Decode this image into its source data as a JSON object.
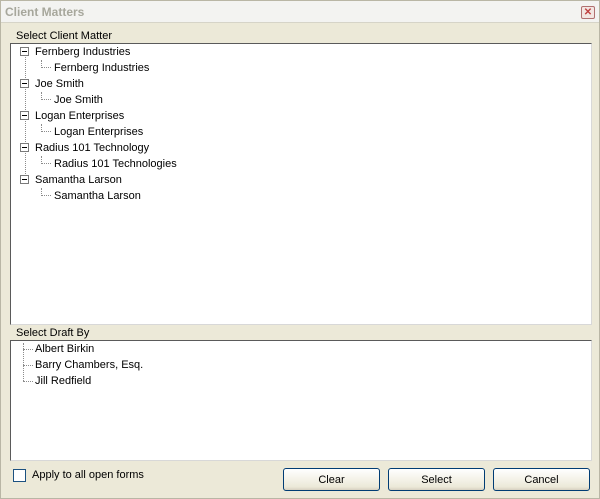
{
  "window": {
    "title": "Client Matters"
  },
  "client_matter": {
    "label": "Select Client Matter",
    "nodes": [
      {
        "label": "Fernberg Industries",
        "child": "Fernberg Industries"
      },
      {
        "label": "Joe Smith",
        "child": "Joe Smith"
      },
      {
        "label": "Logan Enterprises",
        "child": "Logan Enterprises"
      },
      {
        "label": "Radius 101 Technology",
        "child": "Radius 101 Technologies"
      },
      {
        "label": "Samantha Larson",
        "child": "Samantha Larson"
      }
    ]
  },
  "draft_by": {
    "label": "Select Draft By",
    "items": [
      "Albert Birkin",
      "Barry Chambers, Esq.",
      "Jill Redfield"
    ]
  },
  "footer": {
    "apply_all_label": "Apply to all open forms",
    "apply_all_checked": false,
    "clear_label": "Clear",
    "select_label": "Select",
    "cancel_label": "Cancel"
  },
  "icons": {
    "close": "close-icon",
    "expand": "collapse-minus-icon"
  },
  "colors": {
    "dialog_bg": "#ECE9D8",
    "title_text": "#a7a79c",
    "button_border": "#003c74"
  }
}
